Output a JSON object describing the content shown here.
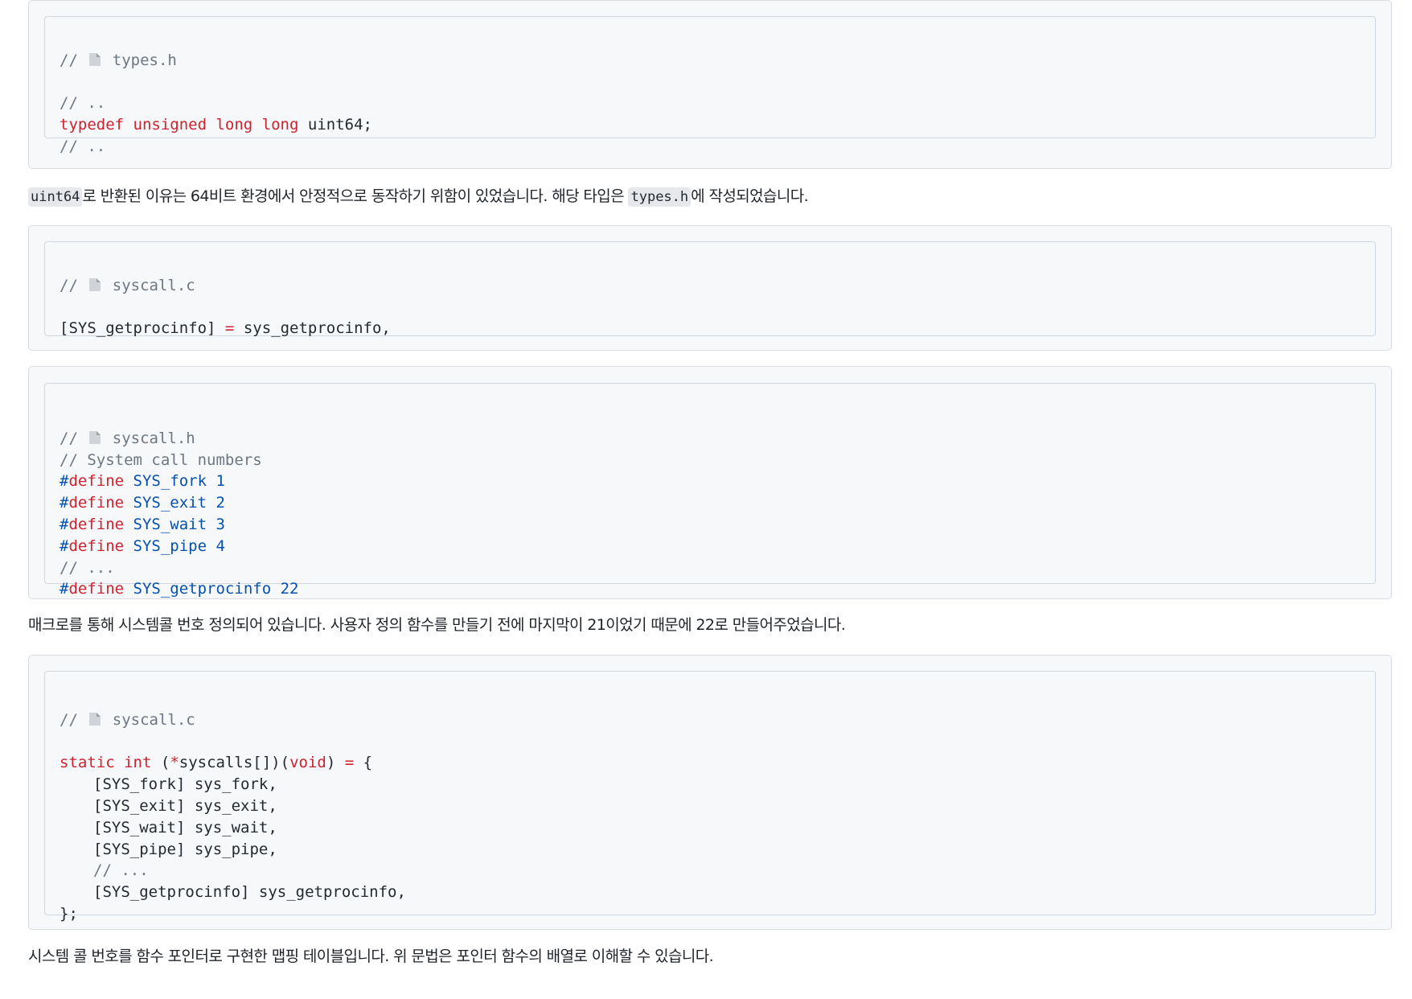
{
  "file_icon": "file-icon",
  "block1": {
    "lines": [
      "// ",
      "types.h",
      "// ..",
      "typedef unsigned long long",
      "uint64;",
      "// .."
    ]
  },
  "para1": {
    "code1": "uint64",
    "text1": "로 반환된 이유는 64비트 환경에서 안정적으로 동작하기 위함이 있었습니다. 해당 타입은 ",
    "code2": "types.h",
    "text2": "에 작성되었습니다."
  },
  "block2": {
    "comment": "// ",
    "filename": "syscall.c",
    "line_left": "[SYS_getprocinfo]",
    "line_op": "=",
    "line_right": "sys_getprocinfo,"
  },
  "block3": {
    "comment": "// ",
    "filename": "syscall.h",
    "comment2": "// System call numbers",
    "defines": [
      {
        "hash": "#",
        "kw": "define",
        "name": "SYS_fork",
        "num": "1"
      },
      {
        "hash": "#",
        "kw": "define",
        "name": "SYS_exit",
        "num": "2"
      },
      {
        "hash": "#",
        "kw": "define",
        "name": "SYS_wait",
        "num": "3"
      },
      {
        "hash": "#",
        "kw": "define",
        "name": "SYS_pipe",
        "num": "4"
      }
    ],
    "ellipsis": "// ...",
    "last_define": {
      "hash": "#",
      "kw": "define",
      "name": "SYS_getprocinfo",
      "num": "22"
    }
  },
  "para2": {
    "text": "매크로를 통해 시스템콜 번호 정의되어 있습니다. 사용자 정의 함수를 만들기 전에 마지막이 21이었기 때문에 22로 만들어주었습니다."
  },
  "block4": {
    "comment": "// ",
    "filename": "syscall.c",
    "decl_static": "static",
    "decl_int": "int",
    "decl_open": "(",
    "decl_star": "*",
    "decl_name": "syscalls[])(",
    "decl_void": "void",
    "decl_close": ")",
    "decl_eq": "=",
    "decl_brace": "{",
    "entries": [
      "[SYS_fork] sys_fork,",
      "[SYS_exit] sys_exit,",
      "[SYS_wait] sys_wait,",
      "[SYS_pipe] sys_pipe,"
    ],
    "ellipsis": "// ...",
    "last_entry": "[SYS_getprocinfo] sys_getprocinfo,",
    "end": "};"
  },
  "para3": {
    "text": "시스템 콜 번호를 함수 포인터로 구현한 맵핑 테이블입니다. 위 문법은 포인터 함수의 배열로 이해할 수 있습니다."
  }
}
